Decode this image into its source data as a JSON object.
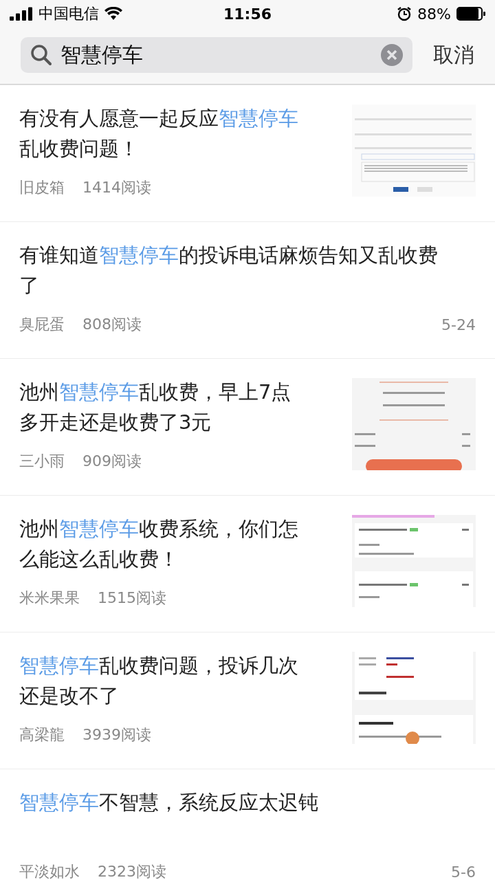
{
  "status_bar": {
    "carrier": "中国电信",
    "time": "11:56",
    "battery": "88%",
    "level": 0.88
  },
  "search": {
    "value": "智慧停车",
    "cancel": "取消"
  },
  "results": [
    {
      "title": [
        {
          "text": "有没有人愿意一起反应",
          "highlight": false
        },
        {
          "text": "智慧停车",
          "highlight": true
        },
        {
          "text": "乱收费问题！",
          "highlight": false
        }
      ],
      "author": "旧皮箱",
      "reads": "1414阅读",
      "thumbnail": {
        "kind": "form"
      }
    },
    {
      "title": [
        {
          "text": "有谁知道",
          "highlight": false
        },
        {
          "text": "智慧停车",
          "highlight": true
        },
        {
          "text": "的投诉电话麻烦告知又乱收费了",
          "highlight": false
        }
      ],
      "author": "臭屁蛋",
      "reads": "808阅读",
      "date": "5-24"
    },
    {
      "title": [
        {
          "text": "池州",
          "highlight": false
        },
        {
          "text": "智慧停车",
          "highlight": true
        },
        {
          "text": "乱收费，早上7点多开走还是收费了3元",
          "highlight": false
        }
      ],
      "author": "三小雨",
      "reads": "909阅读",
      "thumbnail": {
        "kind": "receipt"
      }
    },
    {
      "title": [
        {
          "text": "池州",
          "highlight": false
        },
        {
          "text": "智慧停车",
          "highlight": true
        },
        {
          "text": "收费系统，你们怎么能这么乱收费！",
          "highlight": false
        }
      ],
      "author": "米米果果",
      "reads": "1515阅读",
      "thumbnail": {
        "kind": "list"
      }
    },
    {
      "title": [
        {
          "text": "智慧停车",
          "highlight": true
        },
        {
          "text": "乱收费问题，投诉几次还是改不了",
          "highlight": false
        }
      ],
      "author": "高梁龍",
      "reads": "3939阅读",
      "thumbnail": {
        "kind": "notice"
      }
    },
    {
      "title": [
        {
          "text": "智慧停车",
          "highlight": true
        },
        {
          "text": "不智慧，系统反应太迟钝",
          "highlight": false
        }
      ],
      "author": "平淡如水",
      "reads": "2323阅读",
      "date": "5-6"
    }
  ]
}
